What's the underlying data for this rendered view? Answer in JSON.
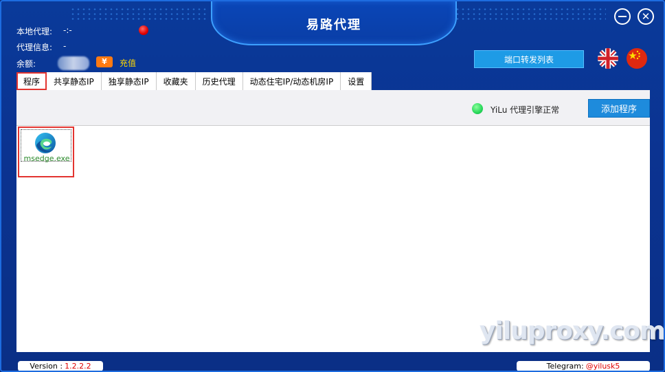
{
  "window": {
    "title": "易路代理"
  },
  "info": {
    "local_proxy_label": "本地代理:",
    "local_proxy_value": "-:-",
    "proxy_info_label": "代理信息:",
    "proxy_info_value": "-",
    "balance_label": "余额:",
    "recharge_icon": "¥",
    "recharge_label": "充值"
  },
  "header": {
    "port_forward_button": "端口转发列表",
    "flags": [
      "uk-flag-icon",
      "cn-flag-icon"
    ]
  },
  "tabs": [
    {
      "label": "程序",
      "active": true
    },
    {
      "label": "共享静态IP"
    },
    {
      "label": "独享静态IP"
    },
    {
      "label": "收藏夹"
    },
    {
      "label": "历史代理"
    },
    {
      "label": "动态住宅IP/动态机房IP"
    },
    {
      "label": "设置"
    }
  ],
  "toolbar": {
    "engine_status": "YiLu 代理引擎正常",
    "add_program_button": "添加程序"
  },
  "apps": [
    {
      "name": "msedge.exe",
      "icon": "edge-icon"
    }
  ],
  "watermark": "yiluproxy.com",
  "footer": {
    "version_label": "Version :",
    "version_value": "1.2.2.2",
    "telegram_label": "Telegram:",
    "telegram_value": "@yilusk5"
  },
  "colors": {
    "background": "#0a3391",
    "accent": "#1e9be6",
    "status_ok": "#27d85a",
    "status_off": "#e00000",
    "recharge": "#ffd800"
  }
}
